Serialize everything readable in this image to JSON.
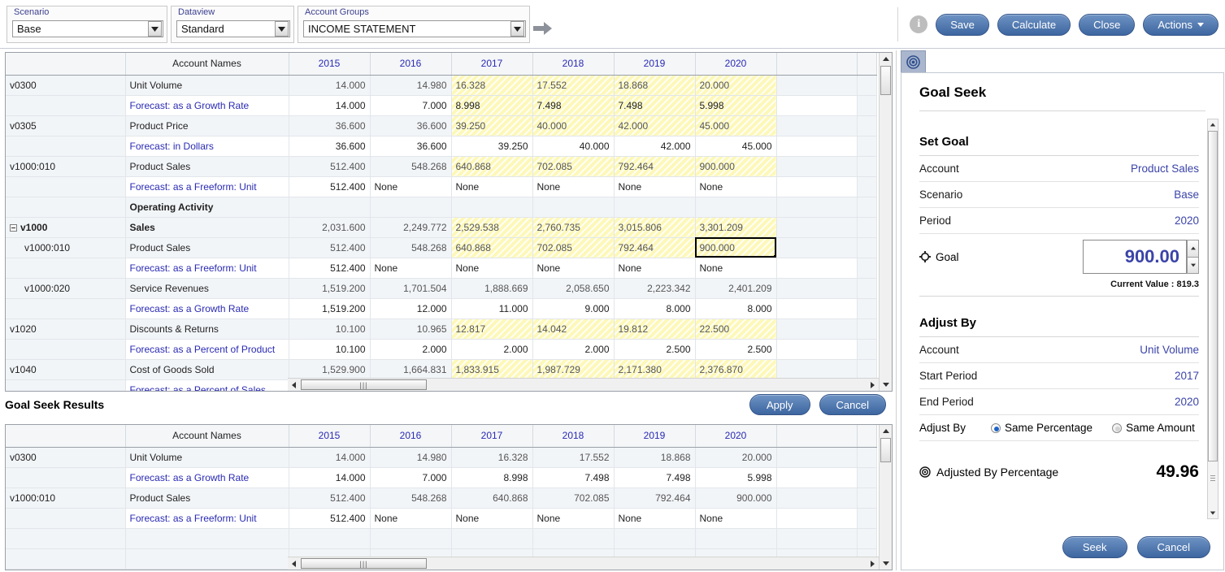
{
  "toolbar": {
    "selectors": [
      {
        "label": "Scenario",
        "value": "Base",
        "icon": "chevron-down-icon"
      },
      {
        "label": "Dataview",
        "value": "Standard",
        "icon": "chevron-down-icon"
      },
      {
        "label": "Account Groups",
        "value": "INCOME STATEMENT",
        "icon": "chevron-down-icon"
      }
    ],
    "go_icon": "arrow-right-icon",
    "info_icon": "info-icon",
    "info_glyph": "i",
    "buttons": [
      {
        "label": "Save",
        "name": "save-button"
      },
      {
        "label": "Calculate",
        "name": "calculate-button"
      },
      {
        "label": "Close",
        "name": "close-button"
      },
      {
        "label": "Actions",
        "name": "actions-button",
        "has_caret": true
      }
    ]
  },
  "main_grid": {
    "columns": [
      "",
      "Account Names",
      "2015",
      "2016",
      "2017",
      "2018",
      "2019",
      "2020",
      "",
      ""
    ],
    "rows": [
      {
        "code": "v0300",
        "name": "Unit Volume",
        "kind": "acct",
        "values": [
          "14.000",
          "14.980",
          "16.328",
          "17.552",
          "18.868",
          "20.000"
        ]
      },
      {
        "code": "",
        "name": "Forecast: as a Growth Rate",
        "kind": "fc",
        "values": [
          "14.000",
          "7.000",
          "8.998",
          "7.498",
          "7.498",
          "5.998"
        ]
      },
      {
        "code": "v0305",
        "name": "Product Price",
        "kind": "acct",
        "values": [
          "36.600",
          "36.600",
          "39.250",
          "40.000",
          "42.000",
          "45.000"
        ]
      },
      {
        "code": "",
        "name": "Forecast: in Dollars",
        "kind": "fc",
        "plain": true,
        "values": [
          "36.600",
          "36.600",
          "39.250",
          "40.000",
          "42.000",
          "45.000"
        ]
      },
      {
        "code": "v1000:010",
        "name": "Product Sales",
        "kind": "acct",
        "values": [
          "512.400",
          "548.268",
          "640.868",
          "702.085",
          "792.464",
          "900.000"
        ]
      },
      {
        "code": "",
        "name": "Forecast: as a Freeform: Unit",
        "kind": "fc",
        "plain": true,
        "values": [
          "512.400",
          "None",
          "None",
          "None",
          "None",
          "None"
        ]
      },
      {
        "code": "",
        "name": "Operating Activity",
        "kind": "group",
        "values": [
          "",
          "",
          "",
          "",
          "",
          ""
        ]
      },
      {
        "code": "v1000",
        "name": "Sales",
        "kind": "acct",
        "bold": true,
        "collapse": true,
        "values": [
          "2,031.600",
          "2,249.772",
          "2,529.538",
          "2,760.735",
          "3,015.806",
          "3,301.209"
        ]
      },
      {
        "code": "v1000:010",
        "name": "Product Sales",
        "kind": "acct",
        "indent": 1,
        "selected_col": 5,
        "values": [
          "512.400",
          "548.268",
          "640.868",
          "702.085",
          "792.464",
          "900.000"
        ]
      },
      {
        "code": "",
        "name": "Forecast: as a Freeform: Unit",
        "kind": "fc",
        "plain": true,
        "values": [
          "512.400",
          "None",
          "None",
          "None",
          "None",
          "None"
        ]
      },
      {
        "code": "v1000:020",
        "name": "Service Revenues",
        "kind": "acct",
        "indent": 1,
        "plainnum": true,
        "values": [
          "1,519.200",
          "1,701.504",
          "1,888.669",
          "2,058.650",
          "2,223.342",
          "2,401.209"
        ]
      },
      {
        "code": "",
        "name": "Forecast: as a Growth Rate",
        "kind": "fc",
        "plain": true,
        "values": [
          "1,519.200",
          "12.000",
          "11.000",
          "9.000",
          "8.000",
          "8.000"
        ]
      },
      {
        "code": "v1020",
        "name": "Discounts & Returns",
        "kind": "acct",
        "values": [
          "10.100",
          "10.965",
          "12.817",
          "14.042",
          "19.812",
          "22.500"
        ]
      },
      {
        "code": "",
        "name": "Forecast: as a Percent of Product",
        "kind": "fc",
        "plain": true,
        "values": [
          "10.100",
          "2.000",
          "2.000",
          "2.000",
          "2.500",
          "2.500"
        ]
      },
      {
        "code": "v1040",
        "name": "Cost of Goods Sold",
        "kind": "acct",
        "values": [
          "1,529.900",
          "1,664.831",
          "1,833.915",
          "1,987.729",
          "2,171.380",
          "2,376.870"
        ]
      },
      {
        "code": "",
        "name": "Forecast: as a Percent of Sales",
        "kind": "fc",
        "plain": true,
        "values": [
          "",
          "",
          "",
          "",
          "",
          ""
        ]
      }
    ]
  },
  "results": {
    "title": "Goal Seek Results",
    "apply_label": "Apply",
    "cancel_label": "Cancel",
    "columns": [
      "",
      "Account Names",
      "2015",
      "2016",
      "2017",
      "2018",
      "2019",
      "2020",
      "",
      ""
    ],
    "rows": [
      {
        "code": "v0300",
        "name": "Unit Volume",
        "kind": "acct",
        "values": [
          "14.000",
          "14.980",
          "16.328",
          "17.552",
          "18.868",
          "20.000"
        ]
      },
      {
        "code": "",
        "name": "Forecast: as a Growth Rate",
        "kind": "fc",
        "plain": true,
        "values": [
          "14.000",
          "7.000",
          "8.998",
          "7.498",
          "7.498",
          "5.998"
        ]
      },
      {
        "code": "v1000:010",
        "name": "Product Sales",
        "kind": "acct",
        "values": [
          "512.400",
          "548.268",
          "640.868",
          "702.085",
          "792.464",
          "900.000"
        ]
      },
      {
        "code": "",
        "name": "Forecast: as a Freeform: Unit",
        "kind": "fc",
        "plain": true,
        "values": [
          "512.400",
          "None",
          "None",
          "None",
          "None",
          "None"
        ]
      },
      {
        "code": "",
        "name": "",
        "kind": "blank",
        "values": [
          "",
          "",
          "",
          "",
          "",
          ""
        ]
      },
      {
        "code": "",
        "name": "",
        "kind": "blank",
        "values": [
          "",
          "",
          "",
          "",
          "",
          ""
        ]
      }
    ]
  },
  "goal_seek": {
    "tab_icon": "bullseye-icon",
    "title": "Goal Seek",
    "set_goal": {
      "heading": "Set Goal",
      "account_label": "Account",
      "account_value": "Product Sales",
      "scenario_label": "Scenario",
      "scenario_value": "Base",
      "period_label": "Period",
      "period_value": "2020",
      "goal_label": "Goal",
      "goal_icon": "target-icon",
      "goal_value": "900.00",
      "current_value": "Current Value : 819.3"
    },
    "adjust_by": {
      "heading": "Adjust By",
      "account_label": "Account",
      "account_value": "Unit Volume",
      "start_label": "Start Period",
      "start_value": "2017",
      "end_label": "End Period",
      "end_value": "2020",
      "mode_label": "Adjust By",
      "option_percentage": "Same Percentage",
      "option_amount": "Same Amount",
      "selected_mode": "Same Percentage",
      "result_label": "Adjusted By Percentage",
      "result_icon": "bullseye-icon",
      "result_value": "49.96"
    },
    "seek_label": "Seek",
    "cancel_label": "Cancel"
  },
  "colors": {
    "accent_blue": "#3d66a0",
    "link_blue": "#2a2ab4",
    "highlight_yellow": "#fdf8b8",
    "panel_tab": "#aab6cd"
  }
}
